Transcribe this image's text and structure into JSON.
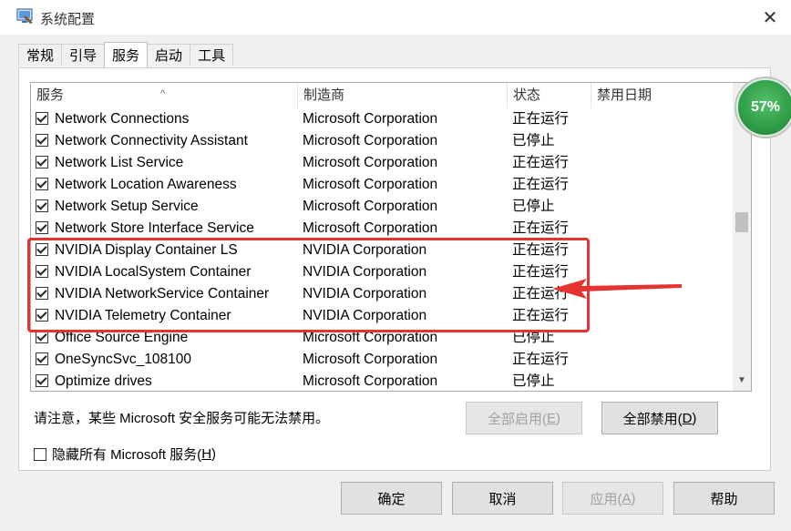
{
  "window": {
    "title": "系统配置",
    "close_glyph": "✕"
  },
  "tabs": [
    "常规",
    "引导",
    "服务",
    "启动",
    "工具"
  ],
  "active_tab": "服务",
  "table": {
    "headers": {
      "service": "服务",
      "manufacturer": "制造商",
      "status": "状态",
      "disabled_date": "禁用日期"
    },
    "rows": [
      {
        "checked": true,
        "name": "Network Connections",
        "manufacturer": "Microsoft Corporation",
        "status": "正在运行"
      },
      {
        "checked": true,
        "name": "Network Connectivity Assistant",
        "manufacturer": "Microsoft Corporation",
        "status": "已停止"
      },
      {
        "checked": true,
        "name": "Network List Service",
        "manufacturer": "Microsoft Corporation",
        "status": "正在运行"
      },
      {
        "checked": true,
        "name": "Network Location Awareness",
        "manufacturer": "Microsoft Corporation",
        "status": "正在运行"
      },
      {
        "checked": true,
        "name": "Network Setup Service",
        "manufacturer": "Microsoft Corporation",
        "status": "已停止"
      },
      {
        "checked": true,
        "name": "Network Store Interface Service",
        "manufacturer": "Microsoft Corporation",
        "status": "正在运行"
      },
      {
        "checked": true,
        "name": "NVIDIA Display Container LS",
        "manufacturer": "NVIDIA Corporation",
        "status": "正在运行"
      },
      {
        "checked": true,
        "name": "NVIDIA LocalSystem Container",
        "manufacturer": "NVIDIA Corporation",
        "status": "正在运行"
      },
      {
        "checked": true,
        "name": "NVIDIA NetworkService Container",
        "manufacturer": "NVIDIA Corporation",
        "status": "正在运行"
      },
      {
        "checked": true,
        "name": "NVIDIA Telemetry Container",
        "manufacturer": "NVIDIA Corporation",
        "status": "正在运行"
      },
      {
        "checked": true,
        "name": "Office  Source Engine",
        "manufacturer": "Microsoft Corporation",
        "status": "已停止"
      },
      {
        "checked": true,
        "name": "OneSyncSvc_108100",
        "manufacturer": "Microsoft Corporation",
        "status": "正在运行"
      },
      {
        "checked": true,
        "name": "Optimize drives",
        "manufacturer": "Microsoft Corporation",
        "status": "已停止"
      }
    ]
  },
  "badge": {
    "text": "57%"
  },
  "notice": "请注意，某些 Microsoft 安全服务可能无法禁用。",
  "buttons": {
    "enable_all": {
      "label": "全部启用(",
      "key": "E",
      "end": ")"
    },
    "disable_all": {
      "label": "全部禁用(",
      "key": "D",
      "end": ")"
    },
    "ok": "确定",
    "cancel": "取消",
    "apply": {
      "label": "应用(",
      "key": "A",
      "end": ")"
    },
    "help": "帮助"
  },
  "hide_ms": {
    "label": "隐藏所有 Microsoft 服务(",
    "key": "H",
    "end": ")",
    "checked": false
  },
  "colors": {
    "highlight": "#e53430",
    "badge": "#2f9e48"
  }
}
